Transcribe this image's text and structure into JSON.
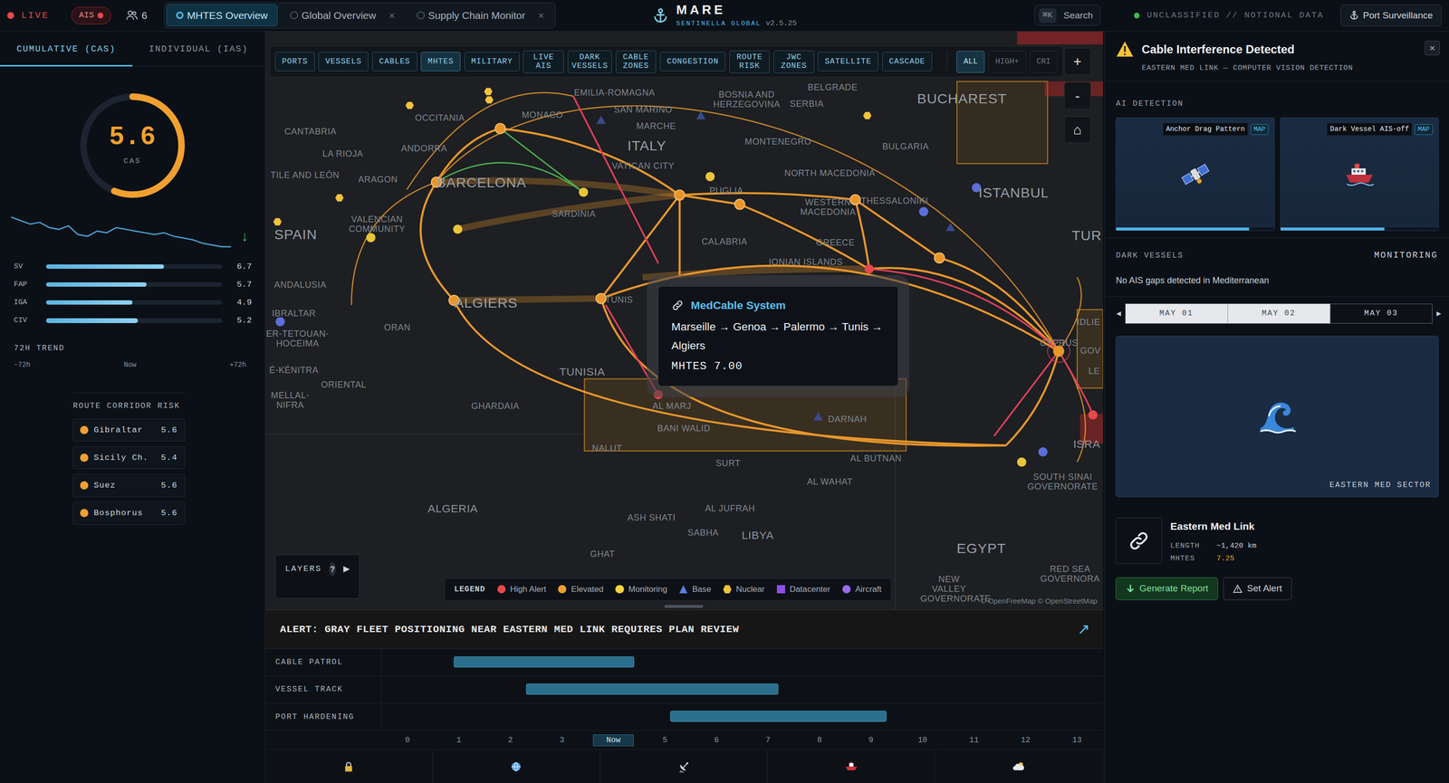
{
  "topbar": {
    "live": "LIVE",
    "ais": "AIS",
    "users": "6",
    "close_glyph": "×",
    "tabs": [
      {
        "label": "MHTES Overview",
        "selected": true,
        "closable": false
      },
      {
        "label": "Global Overview",
        "selected": false,
        "closable": true
      },
      {
        "label": "Supply Chain Monitor",
        "selected": false,
        "closable": true
      }
    ],
    "logo": {
      "title": "MARE",
      "subtitle": "SENTINELLA GLOBAL",
      "version": "v2.5.25"
    },
    "search": {
      "shortcut": "⌘K",
      "label": "Search"
    },
    "classification": "UNCLASSIFIED // NOTIONAL DATA",
    "port_button": "Port Surveillance"
  },
  "left_panel": {
    "tabs": [
      {
        "label": "CUMULATIVE (CAS)",
        "selected": true
      },
      {
        "label": "INDIVIDUAL (IAS)",
        "selected": false
      }
    ],
    "gauge": {
      "value": "5.6",
      "label": "CAS",
      "level": 0.56
    },
    "sparkline": {
      "values": [
        6.3,
        6.2,
        6.1,
        6.15,
        6.0,
        5.95,
        6.05,
        5.8,
        5.75,
        5.9,
        5.85,
        6.0,
        5.95,
        5.9,
        5.85,
        5.8,
        5.85,
        5.75,
        5.7,
        5.65,
        5.55,
        5.5,
        5.45,
        5.45
      ],
      "direction": "↓"
    },
    "bars": [
      {
        "label": "SV",
        "value": "6.7",
        "level": 0.67
      },
      {
        "label": "FAP",
        "value": "5.7",
        "level": 0.57
      },
      {
        "label": "IGA",
        "value": "4.9",
        "level": 0.49
      },
      {
        "label": "CIV",
        "value": "5.2",
        "level": 0.52
      }
    ],
    "trend": {
      "title": "72H TREND",
      "ticks": [
        "-72h",
        "Now",
        "+72h"
      ]
    },
    "corridors": {
      "title": "ROUTE CORRIDOR RISK",
      "items": [
        {
          "name": "Gibraltar",
          "value": "5.6"
        },
        {
          "name": "Sicily Ch.",
          "value": "5.4"
        },
        {
          "name": "Suez",
          "value": "5.6"
        },
        {
          "name": "Bosphorus",
          "value": "5.6"
        }
      ]
    }
  },
  "map": {
    "layer_filters": [
      {
        "label": "PORTS",
        "highlight": false
      },
      {
        "label": "VESSELS",
        "highlight": false
      },
      {
        "label": "CABLES",
        "highlight": false
      },
      {
        "label": "MHTES",
        "highlight": true
      },
      {
        "label": "MILITARY",
        "highlight": false
      },
      {
        "label": "LIVE AIS",
        "highlight": false
      },
      {
        "label": "DARK VESSELS",
        "highlight": false
      },
      {
        "label": "CABLE ZONES",
        "highlight": false
      },
      {
        "label": "CONGESTION",
        "highlight": false
      },
      {
        "label": "ROUTE RISK",
        "highlight": false
      },
      {
        "label": "JWC ZONES",
        "highlight": false
      },
      {
        "label": "SATELLITE",
        "highlight": false
      },
      {
        "label": "CASCADE",
        "highlight": false
      }
    ],
    "severity_filters": [
      {
        "label": "ALL",
        "selected": true
      },
      {
        "label": "HIGH+",
        "selected": false
      },
      {
        "label": "CRI",
        "selected": false
      }
    ],
    "zoom_buttons": [
      "+",
      "-",
      "⌂"
    ],
    "labels": [
      {
        "text": "OCCITANIA",
        "kind": "region"
      },
      {
        "text": "MONACO",
        "kind": "region"
      },
      {
        "text": "EMILIA-ROMAGNA",
        "kind": "region"
      },
      {
        "text": "SAN MARINO",
        "kind": "region"
      },
      {
        "text": "BOSNIA AND HERZEGOVINA",
        "kind": "region"
      },
      {
        "text": "SERBIA",
        "kind": "region"
      },
      {
        "text": "BELGRADE",
        "kind": "region"
      },
      {
        "text": "BUCHAREST",
        "kind": "major"
      },
      {
        "text": "CANTABRIA",
        "kind": "region"
      },
      {
        "text": "ANDORRA",
        "kind": "region"
      },
      {
        "text": "MARCHE",
        "kind": "region"
      },
      {
        "text": "ITALY",
        "kind": "major"
      },
      {
        "text": "MONTENEGRO",
        "kind": "region"
      },
      {
        "text": "BULGARIA",
        "kind": "region"
      },
      {
        "text": "LA RIOJA",
        "kind": "region"
      },
      {
        "text": "VATICAN CITY",
        "kind": "region"
      },
      {
        "text": "NORTH MACEDONIA",
        "kind": "region"
      },
      {
        "text": "TILE AND LEÓN",
        "kind": "region"
      },
      {
        "text": "ARAGON",
        "kind": "region"
      },
      {
        "text": "BARCELONA",
        "kind": "major"
      },
      {
        "text": "PUGLIA",
        "kind": "region"
      },
      {
        "text": "WESTERN MACEDONIA",
        "kind": "region"
      },
      {
        "text": "THESSALONIKI",
        "kind": "region"
      },
      {
        "text": "ISTANBUL",
        "kind": "major"
      },
      {
        "text": "SPAIN",
        "kind": "major"
      },
      {
        "text": "VALENCIAN COMMUNITY",
        "kind": "region"
      },
      {
        "text": "SARDINIA",
        "kind": "region"
      },
      {
        "text": "CALABRIA",
        "kind": "region"
      },
      {
        "text": "GREECE",
        "kind": "region"
      },
      {
        "text": "TUR",
        "kind": "major"
      },
      {
        "text": "IONIAN ISLANDS",
        "kind": "region"
      },
      {
        "text": "ANDALUSIA",
        "kind": "region"
      },
      {
        "text": "IBRALTAR",
        "kind": "region"
      },
      {
        "text": "ALGIERS",
        "kind": "major"
      },
      {
        "text": "TUNIS",
        "kind": "region"
      },
      {
        "text": "ER-TETOUAN-HOCEIMA",
        "kind": "region"
      },
      {
        "text": "ORAN",
        "kind": "region"
      },
      {
        "text": "CYPRUS",
        "kind": "region"
      },
      {
        "text": "É-KÉNITRA",
        "kind": "region"
      },
      {
        "text": "TUNISIA",
        "kind": "country"
      },
      {
        "text": "ORIENTAL",
        "kind": "region"
      },
      {
        "text": "MELLAL-NIFRA",
        "kind": "region"
      },
      {
        "text": "GHARDAIA",
        "kind": "region"
      },
      {
        "text": "AL MARJ",
        "kind": "region"
      },
      {
        "text": "DARNAH",
        "kind": "region"
      },
      {
        "text": "BANI WALID",
        "kind": "region"
      },
      {
        "text": "NALUT",
        "kind": "region"
      },
      {
        "text": "AL BUTNAN",
        "kind": "region"
      },
      {
        "text": "SURT",
        "kind": "region"
      },
      {
        "text": "AL WAHAT",
        "kind": "region"
      },
      {
        "text": "SOUTH SINAI GOVERNORATE",
        "kind": "region"
      },
      {
        "text": "ALGERIA",
        "kind": "country"
      },
      {
        "text": "AL JUFRAH",
        "kind": "region"
      },
      {
        "text": "ASH SHATI",
        "kind": "region"
      },
      {
        "text": "SABHA",
        "kind": "region"
      },
      {
        "text": "LIBYA",
        "kind": "country"
      },
      {
        "text": "EGYPT",
        "kind": "major"
      },
      {
        "text": "GHAT",
        "kind": "region"
      },
      {
        "text": "RED SEA GOVERNORA",
        "kind": "region"
      },
      {
        "text": "NEW VALLEY GOVERNORATE",
        "kind": "region"
      },
      {
        "text": "ISRA",
        "kind": "country"
      },
      {
        "text": "IDLIE",
        "kind": "region"
      },
      {
        "text": "GOV",
        "kind": "region"
      },
      {
        "text": "LE",
        "kind": "region"
      }
    ],
    "tooltip": {
      "title": "MedCable System",
      "route": "Marseille → Genoa → Palermo → Tunis → Algiers",
      "score": "MHTES 7.00"
    },
    "legend": {
      "title": "LEGEND",
      "items": [
        {
          "label": "High Alert",
          "kind": "dot",
          "color": "#e5484d"
        },
        {
          "label": "Elevated",
          "kind": "dot",
          "color": "#f0a030"
        },
        {
          "label": "Monitoring",
          "kind": "dot",
          "color": "#f2d43d"
        },
        {
          "label": "Base",
          "kind": "triangle",
          "color": "#5b7fe8"
        },
        {
          "label": "Nuclear",
          "kind": "hexagon",
          "color": "#f2c23d"
        },
        {
          "label": "Datacenter",
          "kind": "square",
          "color": "#8a4fe8"
        },
        {
          "label": "Aircraft",
          "kind": "dot",
          "color": "#9b6cf0"
        }
      ]
    },
    "layers": {
      "label": "LAYERS",
      "help": "?",
      "arrow": "▶"
    },
    "attribution": "© OpenFreeMap © OpenStreetMap"
  },
  "timeline": {
    "alert": "ALERT: GRAY FLEET POSITIONING NEAR EASTERN MED LINK REQUIRES PLAN REVIEW",
    "expand": "↗",
    "rows": [
      {
        "label": "CABLE PATROL",
        "start": 0.9,
        "end": 4.4
      },
      {
        "label": "VESSEL TRACK",
        "start": 2.3,
        "end": 7.2
      },
      {
        "label": "PORT HARDENING",
        "start": 5.1,
        "end": 9.3
      }
    ],
    "ticks": [
      {
        "label": "0",
        "selected": false
      },
      {
        "label": "1",
        "selected": false
      },
      {
        "label": "2",
        "selected": false
      },
      {
        "label": "3",
        "selected": false
      },
      {
        "label": "Now",
        "selected": true
      },
      {
        "label": "5",
        "selected": false
      },
      {
        "label": "6",
        "selected": false
      },
      {
        "label": "7",
        "selected": false
      },
      {
        "label": "8",
        "selected": false
      },
      {
        "label": "9",
        "selected": false
      },
      {
        "label": "10",
        "selected": false
      },
      {
        "label": "11",
        "selected": false
      },
      {
        "label": "12",
        "selected": false
      },
      {
        "label": "13",
        "selected": false
      }
    ]
  },
  "detail": {
    "title": "Cable Interference Detected",
    "subtitle": "EASTERN MED LINK — COMPUTER VISION DETECTION",
    "close": "×",
    "section": "AI DETECTION",
    "cards": [
      {
        "label": "Anchor Drag Pattern",
        "badge": "MAP",
        "level": 0.84,
        "kind": "satellite"
      },
      {
        "label": "Dark Vessel AIS-off",
        "badge": "MAP",
        "level": 0.66,
        "kind": "ship"
      }
    ],
    "dark_vessels": {
      "title": "DARK VESSELS",
      "status": "MONITORING",
      "message": "No AIS gaps detected in Mediterranean"
    },
    "dates": {
      "prev": "◂",
      "next": "▸",
      "items": [
        {
          "label": "MAY 01",
          "selected": false
        },
        {
          "label": "MAY 02",
          "selected": false
        },
        {
          "label": "MAY 03",
          "selected": true
        }
      ]
    },
    "image": {
      "caption": "EASTERN MED SECTOR"
    },
    "cable": {
      "name": "Eastern Med Link",
      "fields": [
        {
          "label": "LENGTH",
          "value": "~1,420 km",
          "kind": "plain"
        },
        {
          "label": "MHTES",
          "value": "7.25",
          "kind": "score"
        }
      ]
    },
    "buttons": [
      {
        "label": "Generate Report",
        "kind": "primary"
      },
      {
        "label": "Set Alert",
        "kind": "secondary"
      }
    ]
  }
}
